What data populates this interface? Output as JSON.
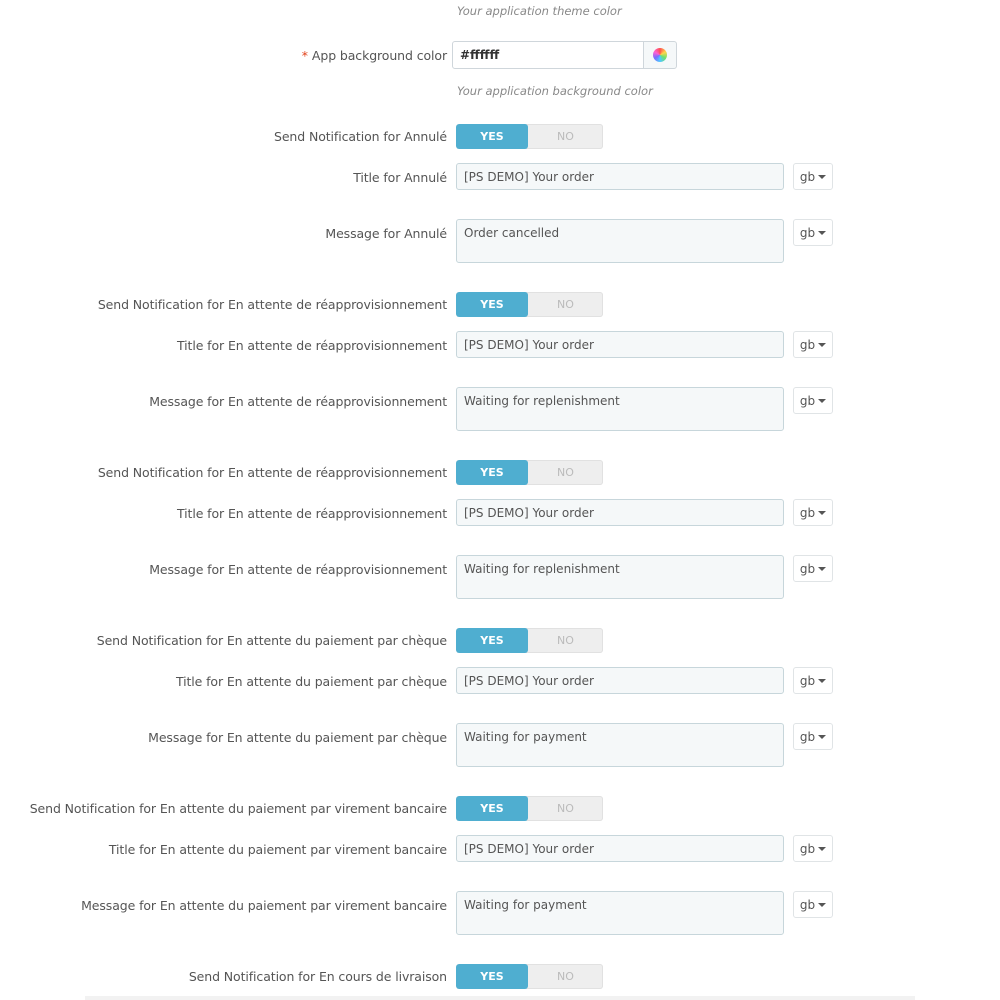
{
  "theme_color_hint": "Your application theme color",
  "app_background": {
    "required_mark": "*",
    "label": "App background color",
    "value": "#ffffff",
    "hint": "Your application background color",
    "picker_icon": "color-wheel-icon"
  },
  "toggle_labels": {
    "yes": "YES",
    "no": "NO"
  },
  "language_selector": "gb",
  "sections": [
    {
      "notify_label": "Send Notification for Annulé",
      "notify_value": "YES",
      "title_label": "Title for Annulé",
      "title_value": "[PS DEMO] Your order",
      "message_label": "Message for Annulé",
      "message_value": "Order cancelled"
    },
    {
      "notify_label": "Send Notification for En attente de réapprovisionnement",
      "notify_value": "YES",
      "title_label": "Title for En attente de réapprovisionnement",
      "title_value": "[PS DEMO] Your order",
      "message_label": "Message for En attente de réapprovisionnement",
      "message_value": "Waiting for replenishment"
    },
    {
      "notify_label": "Send Notification for En attente de réapprovisionnement",
      "notify_value": "YES",
      "title_label": "Title for En attente de réapprovisionnement",
      "title_value": "[PS DEMO] Your order",
      "message_label": "Message for En attente de réapprovisionnement",
      "message_value": "Waiting for replenishment"
    },
    {
      "notify_label": "Send Notification for En attente du paiement par chèque",
      "notify_value": "YES",
      "title_label": "Title for En attente du paiement par chèque",
      "title_value": "[PS DEMO] Your order",
      "message_label": "Message for En attente du paiement par chèque",
      "message_value": "Waiting for payment"
    },
    {
      "notify_label": "Send Notification for En attente du paiement par virement bancaire",
      "notify_value": "YES",
      "title_label": "Title for En attente du paiement par virement bancaire",
      "title_value": "[PS DEMO] Your order",
      "message_label": "Message for En attente du paiement par virement bancaire",
      "message_value": "Waiting for payment"
    },
    {
      "notify_label": "Send Notification for En cours de livraison",
      "notify_value": "YES"
    }
  ]
}
